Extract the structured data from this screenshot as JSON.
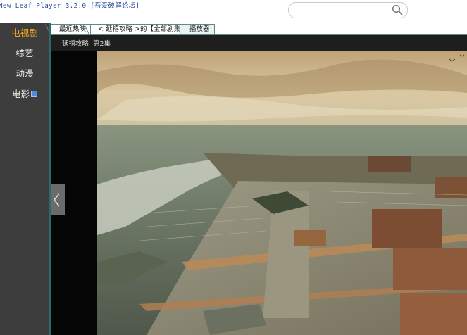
{
  "app": {
    "title": "New Leaf Player 3.2.0 [吾爱破解论坛]"
  },
  "search": {
    "value": "",
    "placeholder": ""
  },
  "sidebar": {
    "items": [
      {
        "label": "电视剧",
        "active": true
      },
      {
        "label": "综艺",
        "active": false
      },
      {
        "label": "动漫",
        "active": false
      },
      {
        "label": "电影",
        "active": false,
        "badge": true
      }
    ]
  },
  "tabs": [
    {
      "label": "最近热映"
    },
    {
      "label": "< 延禧攻略 >的【全部剧集】"
    },
    {
      "label": "播放器",
      "active": true
    }
  ],
  "subbar": {
    "show": "延禧攻略",
    "episode": "第2集"
  },
  "colors": {
    "sidebar_bg": "#3d3d3d",
    "active_accent": "#f5a623",
    "tab_border": "#5a8a8a",
    "subbar_bg": "#1e1e1e"
  },
  "icons": {
    "search": "search-icon",
    "prev": "chevron-left-icon",
    "badge": "new-badge-icon"
  }
}
